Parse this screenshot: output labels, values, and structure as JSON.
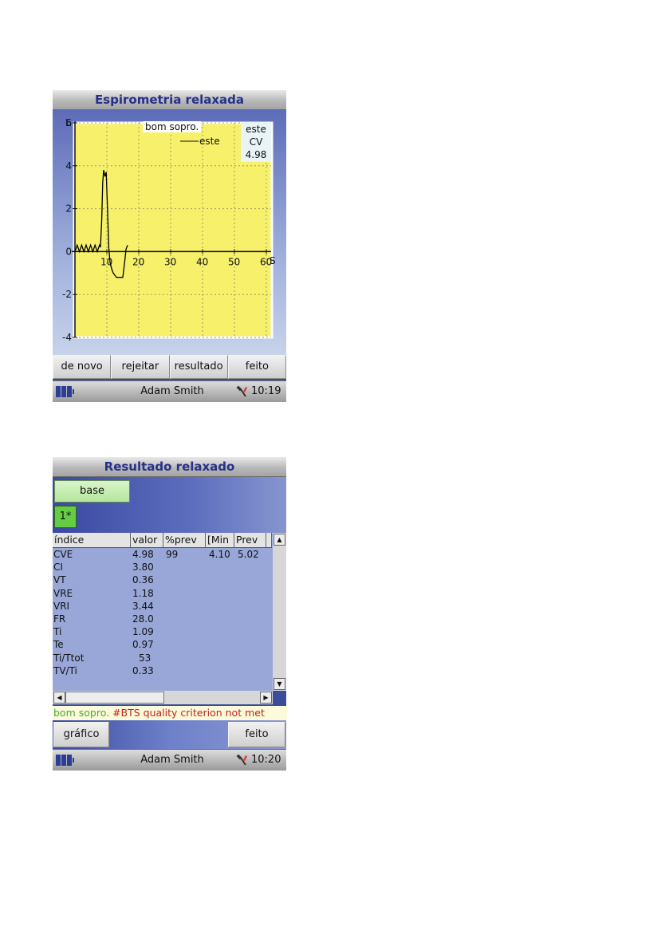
{
  "screen1": {
    "title": "Espirometria relaxada",
    "chart_annotations": {
      "quality": "bom sopro.",
      "legend_label": "este",
      "info_lines": [
        "este",
        "CV",
        "4.98"
      ]
    },
    "buttons": [
      "de novo",
      "rejeitar",
      "resultado",
      "feito"
    ],
    "status": {
      "user": "Adam Smith",
      "time": "10:19"
    }
  },
  "chart_data": {
    "type": "line",
    "title": "",
    "xlabel": "S",
    "ylabel": "L",
    "xlim": [
      0,
      60
    ],
    "ylim": [
      -4,
      6
    ],
    "x_ticks": [
      "10",
      "20",
      "30",
      "40",
      "50",
      "60"
    ],
    "y_ticks": [
      "6",
      "4",
      "2",
      "0",
      "-2",
      "-4"
    ],
    "grid": true,
    "background": "#f7f06a",
    "legend_position": "top-center",
    "series": [
      {
        "name": "este",
        "color": "#000000",
        "x": [
          0,
          0.7,
          1.4,
          2.1,
          2.8,
          3.5,
          4.2,
          4.9,
          5.6,
          6.3,
          7.0,
          7.7,
          8.0,
          8.4,
          8.7,
          9.0,
          9.4,
          9.8,
          10.2,
          10.6,
          11.0,
          11.5,
          12.0,
          13.0,
          14.0,
          15.0,
          15.5,
          15.8,
          16.0,
          16.5
        ],
        "y": [
          0,
          0.3,
          0,
          0.3,
          0,
          0.3,
          0,
          0.3,
          0,
          0.3,
          0,
          0.3,
          0.2,
          1.5,
          3.2,
          3.8,
          3.5,
          3.7,
          2.0,
          0.2,
          -0.5,
          -0.8,
          -1.0,
          -1.2,
          -1.2,
          -1.2,
          -0.6,
          -0.2,
          0.1,
          0.3
        ]
      }
    ]
  },
  "screen2": {
    "title": "Resultado relaxado",
    "base_label": "base",
    "trial_label": "1*",
    "columns": [
      "índice",
      "valor",
      "%prev",
      "[Min",
      "Prev"
    ],
    "rows": [
      {
        "name": "CVE",
        "value": "4.98",
        "pct": "99",
        "min": "4.10",
        "prev": "5.02"
      },
      {
        "name": "CI",
        "value": "3.80",
        "pct": "",
        "min": "",
        "prev": ""
      },
      {
        "name": "VT",
        "value": "0.36",
        "pct": "",
        "min": "",
        "prev": ""
      },
      {
        "name": "VRE",
        "value": "1.18",
        "pct": "",
        "min": "",
        "prev": ""
      },
      {
        "name": "VRI",
        "value": "3.44",
        "pct": "",
        "min": "",
        "prev": ""
      },
      {
        "name": "FR",
        "value": "28.0",
        "pct": "",
        "min": "",
        "prev": ""
      },
      {
        "name": "Ti",
        "value": "1.09",
        "pct": "",
        "min": "",
        "prev": ""
      },
      {
        "name": "Te",
        "value": "0.97",
        "pct": "",
        "min": "",
        "prev": ""
      },
      {
        "name": "Ti/Ttot",
        "value": "53",
        "pct": "",
        "min": "",
        "prev": ""
      },
      {
        "name": "TV/Ti",
        "value": "0.33",
        "pct": "",
        "min": "",
        "prev": ""
      }
    ],
    "message_good": "bom sopro.",
    "message_bad": " #BTS quality criterion not met",
    "buttons": {
      "left": "gráfico",
      "right": "feito"
    },
    "status": {
      "user": "Adam Smith",
      "time": "10:20"
    }
  }
}
